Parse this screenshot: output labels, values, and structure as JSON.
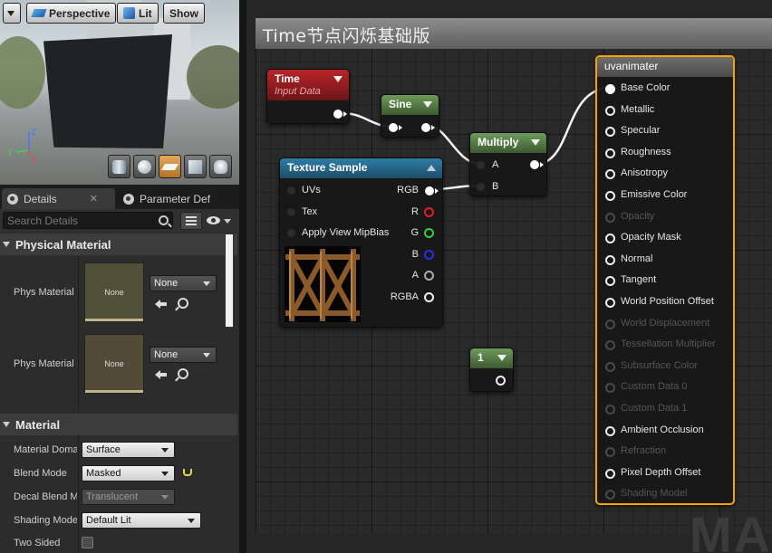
{
  "viewport": {
    "toolbar": {
      "perspective": "Perspective",
      "lit": "Lit",
      "show": "Show"
    },
    "preview_shapes": [
      "cylinder",
      "sphere",
      "plane",
      "cube",
      "custom"
    ],
    "axis": {
      "z": "Z",
      "y": "Y",
      "x": "X"
    }
  },
  "details": {
    "tabs": [
      {
        "label": "Details"
      },
      {
        "label": "Parameter Def"
      }
    ],
    "search_placeholder": "Search Details",
    "physical_material": {
      "heading": "Physical Material",
      "rows": [
        {
          "label": "Phys Material",
          "thumb": "None",
          "value": "None"
        },
        {
          "label": "Phys Material",
          "thumb": "None",
          "value": "None"
        }
      ]
    },
    "material": {
      "heading": "Material",
      "rows": [
        {
          "label": "Material Doma",
          "value": "Surface"
        },
        {
          "label": "Blend Mode",
          "value": "Masked"
        },
        {
          "label": "Decal Blend M",
          "value": "Translucent"
        },
        {
          "label": "Shading Mode",
          "value": "Default Lit"
        },
        {
          "label": "Two Sided",
          "value": ""
        }
      ]
    }
  },
  "graph": {
    "title": "Time节点闪烁基础版",
    "watermark": "MA",
    "accent_color": "#f4a500",
    "nodes": {
      "time": {
        "title": "Time",
        "subtitle": "Input Data"
      },
      "sine": {
        "title": "Sine"
      },
      "multiply": {
        "title": "Multiply",
        "inputs": [
          "A",
          "B"
        ]
      },
      "texture": {
        "title": "Texture Sample",
        "inputs": [
          "UVs",
          "Tex",
          "Apply View MipBias"
        ],
        "outputs": [
          "RGB",
          "R",
          "G",
          "B",
          "A",
          "RGBA"
        ]
      },
      "constant": {
        "title": "1"
      },
      "result": {
        "title": "uvanimater",
        "pins": [
          {
            "label": "Base Color",
            "enabled": true
          },
          {
            "label": "Metallic",
            "enabled": true
          },
          {
            "label": "Specular",
            "enabled": true
          },
          {
            "label": "Roughness",
            "enabled": true
          },
          {
            "label": "Anisotropy",
            "enabled": true
          },
          {
            "label": "Emissive Color",
            "enabled": true
          },
          {
            "label": "Opacity",
            "enabled": false
          },
          {
            "label": "Opacity Mask",
            "enabled": true
          },
          {
            "label": "Normal",
            "enabled": true
          },
          {
            "label": "Tangent",
            "enabled": true
          },
          {
            "label": "World Position Offset",
            "enabled": true
          },
          {
            "label": "World Displacement",
            "enabled": false
          },
          {
            "label": "Tessellation Multiplier",
            "enabled": false
          },
          {
            "label": "Subsurface Color",
            "enabled": false
          },
          {
            "label": "Custom Data 0",
            "enabled": false
          },
          {
            "label": "Custom Data 1",
            "enabled": false
          },
          {
            "label": "Ambient Occlusion",
            "enabled": true
          },
          {
            "label": "Refraction",
            "enabled": false
          },
          {
            "label": "Pixel Depth Offset",
            "enabled": true
          },
          {
            "label": "Shading Model",
            "enabled": false
          }
        ]
      }
    }
  }
}
